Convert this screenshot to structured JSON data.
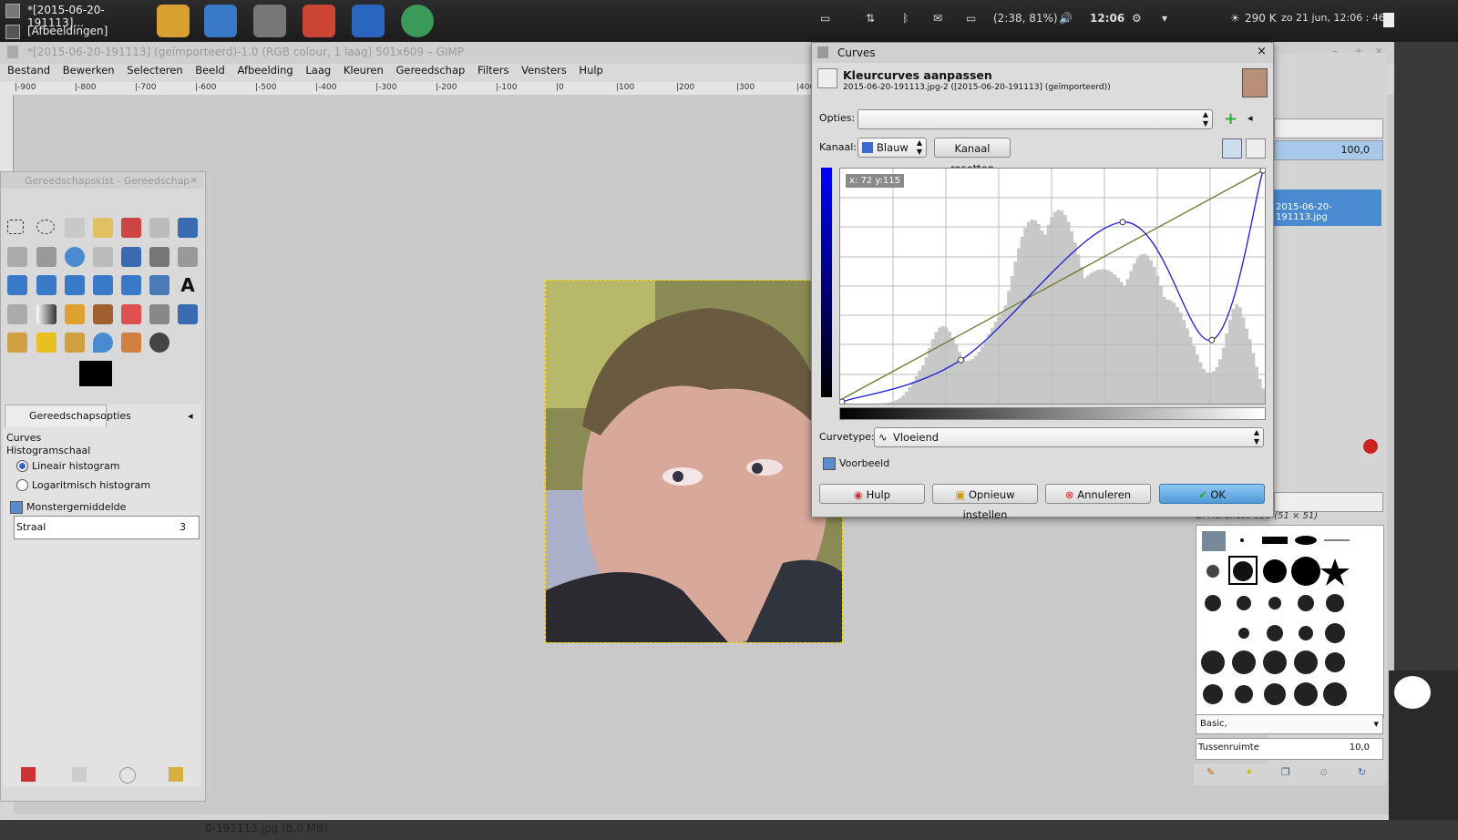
{
  "panel": {
    "tasks": [
      "*[2015-06-20-191113]...",
      "[Afbeeldingen]"
    ],
    "battery": "(2:38, 81%)",
    "time": "12:06",
    "weather": "290 K",
    "datetime": "zo 21 jun, 12:06 : 46"
  },
  "gimp": {
    "title": "*[2015-06-20-191113] (geïmporteerd)-1.0 (RGB colour, 1 laag) 501x609 – GIMP",
    "menu": [
      "Bestand",
      "Bewerken",
      "Selecteren",
      "Beeld",
      "Afbeelding",
      "Laag",
      "Kleuren",
      "Gereedschap",
      "Filters",
      "Vensters",
      "Hulp"
    ],
    "ruler_ticks": [
      "-900",
      "-800",
      "-700",
      "-600",
      "-500",
      "-400",
      "-300",
      "-200",
      "-100",
      "0",
      "100",
      "200",
      "300",
      "400"
    ],
    "status": "0-191113.jpg (8,0 MB)"
  },
  "toolbox": {
    "title": "Gereedschapskist - Gereedschap",
    "options_tab": "Gereedschapsopties",
    "tool_name": "Curves",
    "histogram_scale": "Histogramschaal",
    "linear": "Lineair histogram",
    "log": "Logaritmisch histogram",
    "sample_average": "Monstergemiddelde",
    "radius_label": "Straal",
    "radius_value": "3"
  },
  "dock": {
    "opacity": "100,0",
    "image_name": "2015-06-20-191113.jpg",
    "brush_title": "2. Hardness 050 (51 × 51)",
    "brush_set": "Basic,",
    "spacing_label": "Tussenruimte",
    "spacing_value": "10,0"
  },
  "curves": {
    "window_title": "Curves",
    "heading": "Kleurcurves aanpassen",
    "subheading": "2015-06-20-191113.jpg-2 ([2015-06-20-191113] (geïmporteerd))",
    "options_label": "Opties:",
    "channel_label": "Kanaal:",
    "channel": "Blauw",
    "reset_channel": "Kanaal resetten",
    "coords": "x: 72 y:115",
    "curvetype_label": "Curvetype:",
    "curvetype": "Vloeiend",
    "preview": "Voorbeeld",
    "help": "Hulp",
    "reset": "Opnieuw instellen",
    "cancel": "Annuleren",
    "ok": "OK",
    "points": [
      [
        0,
        0
      ],
      [
        72,
        46
      ],
      [
        224,
        68
      ],
      [
        255,
        255
      ],
      [
        170,
        198
      ]
    ]
  }
}
